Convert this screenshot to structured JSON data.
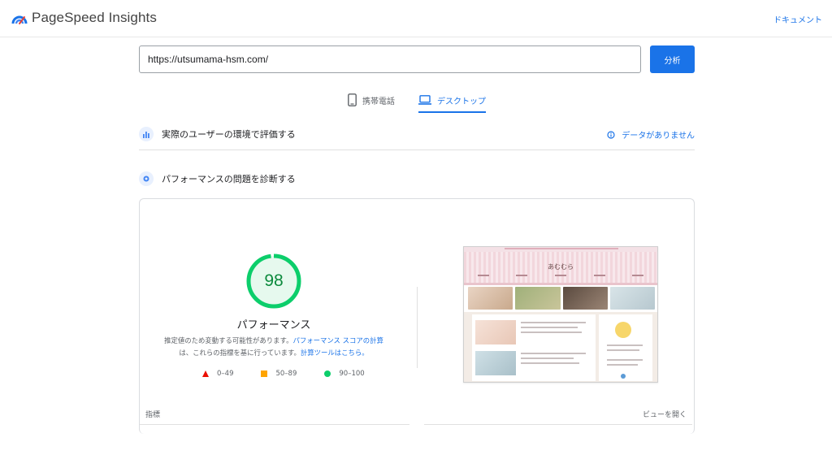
{
  "header": {
    "app_title": "PageSpeed Insights",
    "docs_link": "ドキュメント"
  },
  "search": {
    "url_value": "https://utsumama-hsm.com/",
    "analyze_label": "分析"
  },
  "tabs": [
    {
      "label": "携帯電話",
      "icon": "smartphone-icon",
      "active": false
    },
    {
      "label": "デスクトップ",
      "icon": "laptop-icon",
      "active": true
    }
  ],
  "field_data": {
    "title": "実際のユーザーの環境で評価する",
    "no_data_label": "データがありません"
  },
  "lab": {
    "title": "パフォーマンスの問題を診断する",
    "score": "98",
    "score_label": "パフォーマンス",
    "desc_part1": "推定値のため変動する可能性があります。",
    "desc_link1": "パフォーマンス スコアの計算",
    "desc_part2": "は、これらの指標を基に行っています。",
    "desc_link2": "計算ツールはこちら。",
    "legend": [
      {
        "range": "0–49",
        "shape": "triangle",
        "color": "#eb0f00"
      },
      {
        "range": "50–89",
        "shape": "square",
        "color": "#ffa400"
      },
      {
        "range": "90–100",
        "shape": "circle",
        "color": "#0cce6b"
      }
    ],
    "screenshot_site_title": "あむむら",
    "metrics_label": "指標",
    "view_toggle": "ビューを開く"
  },
  "colors": {
    "accent": "#1a73e8",
    "pass_green": "#0cce6b",
    "score_text": "#0c8a3d"
  }
}
